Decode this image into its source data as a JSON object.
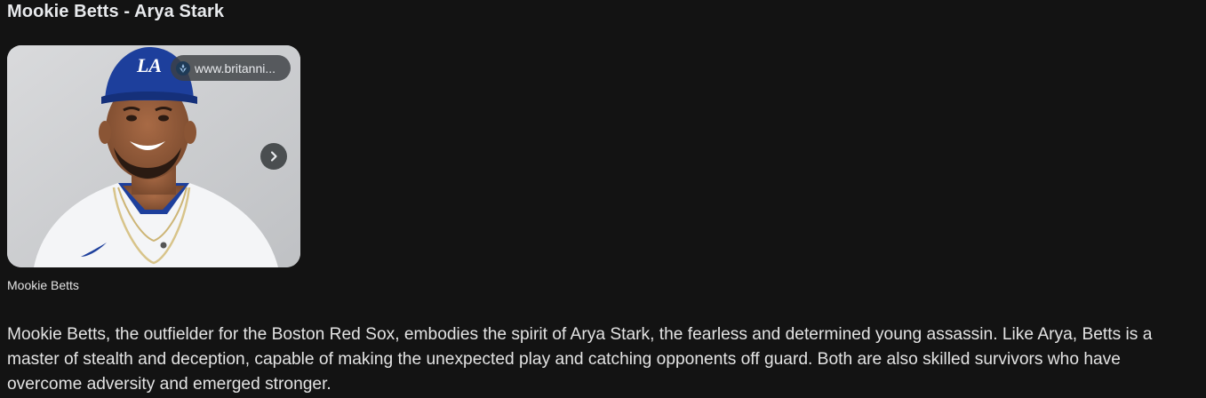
{
  "heading": "Mookie Betts - Arya Stark",
  "image_card": {
    "source_label": "www.britanni...",
    "source_favicon": "britannica-thistle-icon",
    "next_icon": "chevron-right-icon",
    "cap_logo": "LA",
    "caption": "Mookie Betts"
  },
  "body": {
    "text": "Mookie Betts, the outfielder for the Boston Red Sox, embodies the spirit of Arya Stark, the fearless and determined young assassin. Like Arya, Betts is a master of stealth and deception, capable of making the unexpected play and catching opponents off guard. Both are also skilled survivors who have overcome adversity and emerged stronger."
  },
  "colors": {
    "background": "#131313",
    "text": "#e3e3e3",
    "dodger_blue": "#1d3f9c",
    "chip_background": "#3c4043"
  }
}
